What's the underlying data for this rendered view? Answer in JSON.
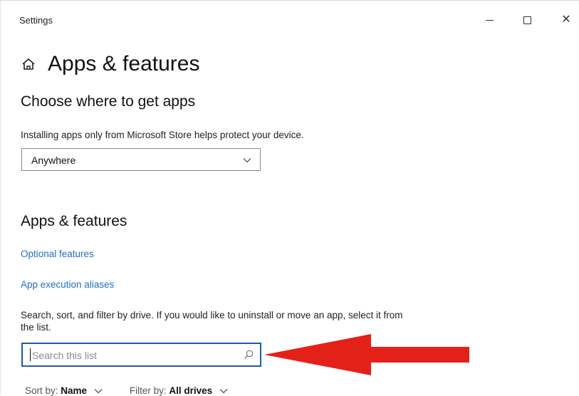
{
  "window": {
    "title": "Settings",
    "controls": {
      "minimize": "minimize-icon",
      "maximize": "maximize-icon",
      "close": "close-icon"
    }
  },
  "header": {
    "title": "Apps & features",
    "icon": "home-icon"
  },
  "choose_section": {
    "heading": "Choose where to get apps",
    "description": "Installing apps only from Microsoft Store helps protect your device.",
    "dropdown_value": "Anywhere"
  },
  "apps_section": {
    "heading": "Apps & features",
    "links": {
      "optional_features": "Optional features",
      "app_execution_aliases": "App execution aliases"
    },
    "description": "Search, sort, and filter by drive. If you would like to uninstall or move an app, select it from the list.",
    "search": {
      "placeholder": "Search this list",
      "value": ""
    },
    "sort": {
      "label": "Sort by:",
      "value": "Name"
    },
    "filter": {
      "label": "Filter by:",
      "value": "All drives"
    }
  },
  "annotation": {
    "arrow_color": "#e32119",
    "arrow_icon": "red-arrow"
  },
  "colors": {
    "link": "#1f6fc5",
    "focus_border": "#1f5aa8"
  }
}
